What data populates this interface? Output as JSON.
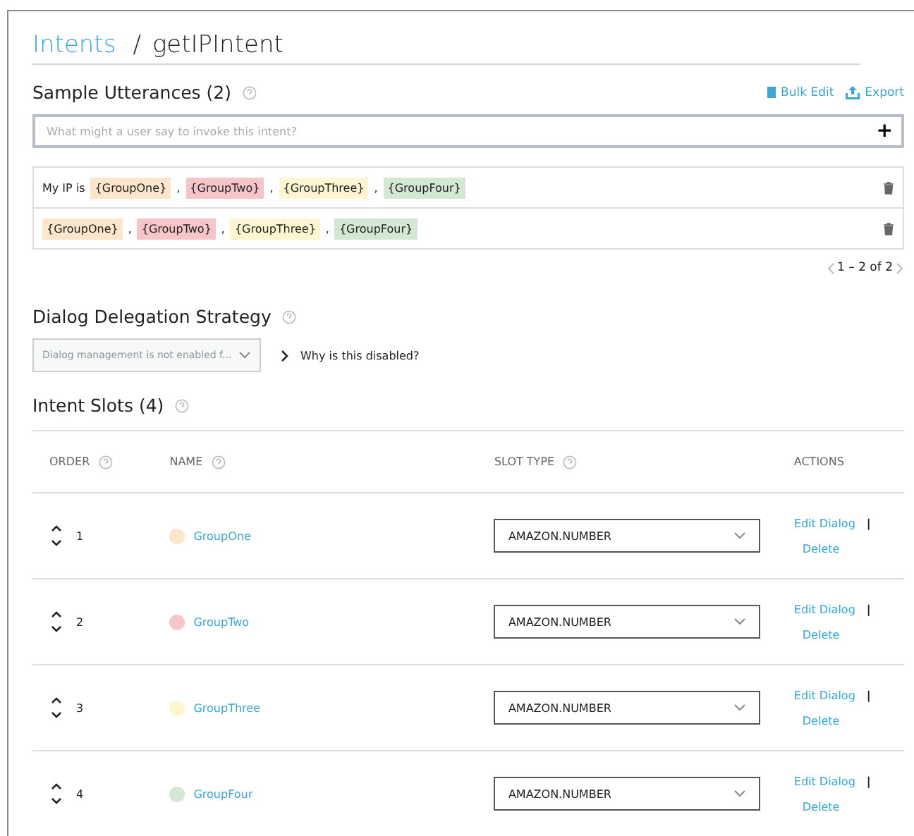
{
  "breadcrumb": {
    "parent": "Intents",
    "separator": "/",
    "current": "getIPIntent"
  },
  "utterances_section": {
    "title": "Sample Utterances (2)",
    "actions": [
      "Bulk Edit",
      "Export"
    ],
    "input": {
      "placeholder": "What might a user say to invoke this intent?"
    },
    "add_button": "+",
    "rows": [
      {
        "parts": [
          {
            "kind": "text",
            "text": "My IP is"
          },
          {
            "kind": "slot",
            "text": "{GroupOne}",
            "color": "#fbe5cb"
          },
          {
            "kind": "text",
            "text": ","
          },
          {
            "kind": "slot",
            "text": "{GroupTwo}",
            "color": "#f6c5c8"
          },
          {
            "kind": "text",
            "text": ","
          },
          {
            "kind": "slot",
            "text": "{GroupThree}",
            "color": "#fdf6d0"
          },
          {
            "kind": "text",
            "text": ","
          },
          {
            "kind": "slot",
            "text": "{GroupFour}",
            "color": "#d2e8d3"
          }
        ]
      },
      {
        "parts": [
          {
            "kind": "slot",
            "text": "{GroupOne}",
            "color": "#fbe5cb"
          },
          {
            "kind": "text",
            "text": ","
          },
          {
            "kind": "slot",
            "text": "{GroupTwo}",
            "color": "#f6c5c8"
          },
          {
            "kind": "text",
            "text": ","
          },
          {
            "kind": "slot",
            "text": "{GroupThree}",
            "color": "#fdf6d0"
          },
          {
            "kind": "text",
            "text": ","
          },
          {
            "kind": "slot",
            "text": "{GroupFour}",
            "color": "#d2e8d3"
          }
        ]
      }
    ],
    "pagination": "1 – 2 of 2"
  },
  "dialog_section": {
    "title": "Dialog Delegation Strategy",
    "select": {
      "value": "Dialog management is not enabled f...",
      "disabled": true
    },
    "link": "Why is this disabled?"
  },
  "slots_section": {
    "title": "Intent Slots (4)",
    "columns": [
      "ORDER",
      "NAME",
      "SLOT TYPE",
      "ACTIONS"
    ],
    "rows": [
      {
        "order": "1",
        "name": "GroupOne",
        "color": "#fbe5cb",
        "slot_type": "AMAZON.NUMBER",
        "actions": [
          "Edit Dialog",
          "|",
          "Delete"
        ]
      },
      {
        "order": "2",
        "name": "GroupTwo",
        "color": "#f6c5c8",
        "slot_type": "AMAZON.NUMBER",
        "actions": [
          "Edit Dialog",
          "|",
          "Delete"
        ]
      },
      {
        "order": "3",
        "name": "GroupThree",
        "color": "#fdf6d0",
        "slot_type": "AMAZON.NUMBER",
        "actions": [
          "Edit Dialog",
          "|",
          "Delete"
        ]
      },
      {
        "order": "4",
        "name": "GroupFour",
        "color": "#d2e8d3",
        "slot_type": "AMAZON.NUMBER",
        "actions": [
          "Edit Dialog",
          "|",
          "Delete"
        ]
      }
    ]
  }
}
